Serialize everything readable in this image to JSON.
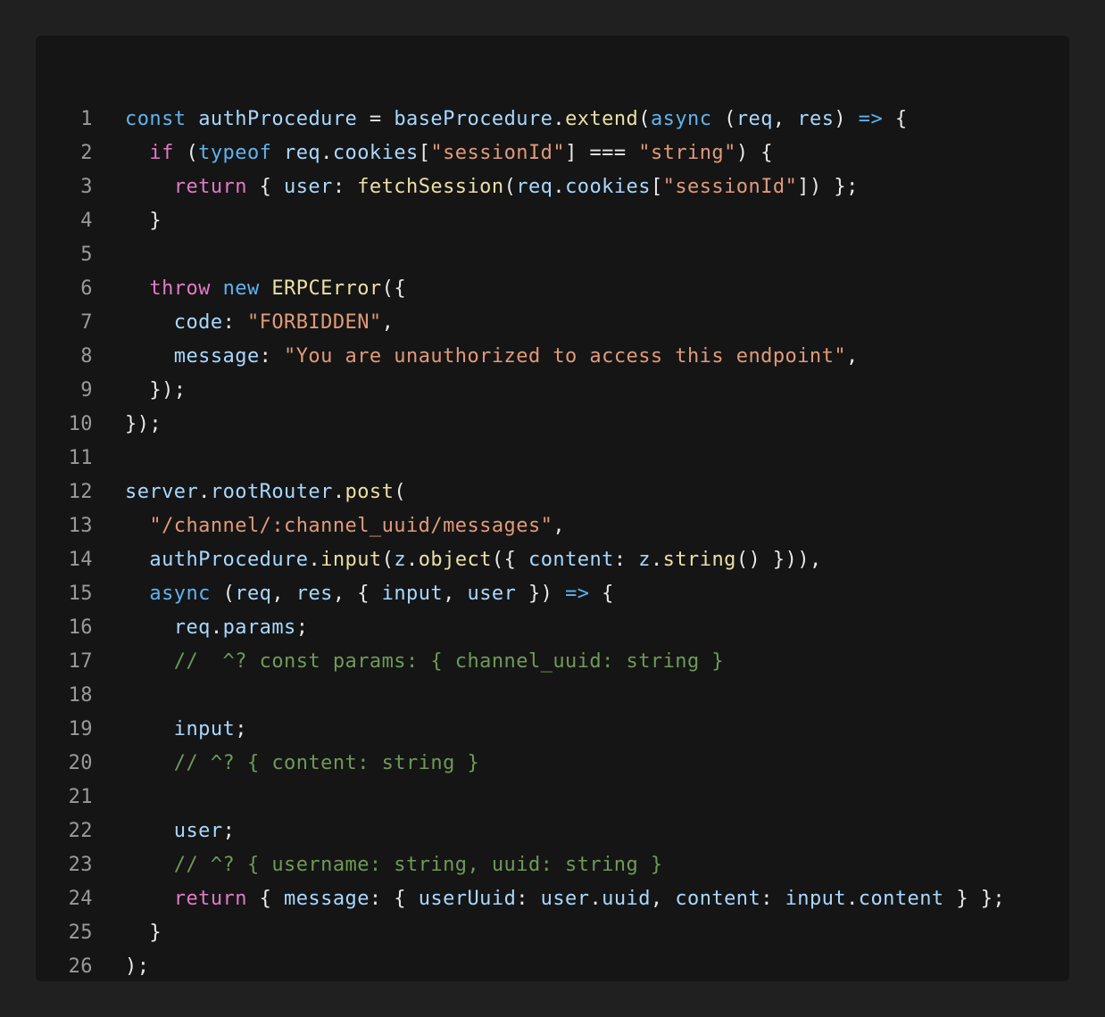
{
  "editor": {
    "colors": {
      "page_background": "#202020",
      "panel_background": "#151515",
      "line_number": "#9a9a9a",
      "keyword": "#5fb3f0",
      "control_keyword": "#e37ac8",
      "function": "#eae0a6",
      "identifier": "#a8d8ff",
      "string": "#e09a7a",
      "comment": "#6e9a57",
      "punctuation": "#e8e8e8"
    },
    "lines": [
      {
        "number": "1",
        "tokens": [
          [
            "kw",
            "const"
          ],
          [
            "pun",
            " "
          ],
          [
            "var",
            "authProcedure"
          ],
          [
            "pun",
            " = "
          ],
          [
            "var",
            "baseProcedure"
          ],
          [
            "pun",
            "."
          ],
          [
            "fn",
            "extend"
          ],
          [
            "pun",
            "("
          ],
          [
            "kw",
            "async"
          ],
          [
            "pun",
            " ("
          ],
          [
            "var",
            "req"
          ],
          [
            "pun",
            ", "
          ],
          [
            "var",
            "res"
          ],
          [
            "pun",
            ") "
          ],
          [
            "kw",
            "=>"
          ],
          [
            "pun",
            " {"
          ]
        ]
      },
      {
        "number": "2",
        "tokens": [
          [
            "pun",
            "  "
          ],
          [
            "ctl",
            "if"
          ],
          [
            "pun",
            " ("
          ],
          [
            "kw",
            "typeof"
          ],
          [
            "pun",
            " "
          ],
          [
            "var",
            "req"
          ],
          [
            "pun",
            "."
          ],
          [
            "var",
            "cookies"
          ],
          [
            "pun",
            "["
          ],
          [
            "str",
            "\"sessionId\""
          ],
          [
            "pun",
            "] === "
          ],
          [
            "str",
            "\"string\""
          ],
          [
            "pun",
            ") {"
          ]
        ]
      },
      {
        "number": "3",
        "tokens": [
          [
            "pun",
            "    "
          ],
          [
            "ctl",
            "return"
          ],
          [
            "pun",
            " { "
          ],
          [
            "var",
            "user"
          ],
          [
            "pun",
            ": "
          ],
          [
            "fn",
            "fetchSession"
          ],
          [
            "pun",
            "("
          ],
          [
            "var",
            "req"
          ],
          [
            "pun",
            "."
          ],
          [
            "var",
            "cookies"
          ],
          [
            "pun",
            "["
          ],
          [
            "str",
            "\"sessionId\""
          ],
          [
            "pun",
            "]) };"
          ]
        ]
      },
      {
        "number": "4",
        "tokens": [
          [
            "pun",
            "  }"
          ]
        ]
      },
      {
        "number": "5",
        "tokens": []
      },
      {
        "number": "6",
        "tokens": [
          [
            "pun",
            "  "
          ],
          [
            "ctl",
            "throw"
          ],
          [
            "pun",
            " "
          ],
          [
            "kw",
            "new"
          ],
          [
            "pun",
            " "
          ],
          [
            "fn",
            "ERPCError"
          ],
          [
            "pun",
            "({"
          ]
        ]
      },
      {
        "number": "7",
        "tokens": [
          [
            "pun",
            "    "
          ],
          [
            "var",
            "code"
          ],
          [
            "pun",
            ": "
          ],
          [
            "str",
            "\"FORBIDDEN\""
          ],
          [
            "pun",
            ","
          ]
        ]
      },
      {
        "number": "8",
        "tokens": [
          [
            "pun",
            "    "
          ],
          [
            "var",
            "message"
          ],
          [
            "pun",
            ": "
          ],
          [
            "str",
            "\"You are unauthorized to access this endpoint\""
          ],
          [
            "pun",
            ","
          ]
        ]
      },
      {
        "number": "9",
        "tokens": [
          [
            "pun",
            "  });"
          ]
        ]
      },
      {
        "number": "10",
        "tokens": [
          [
            "pun",
            "});"
          ]
        ]
      },
      {
        "number": "11",
        "tokens": []
      },
      {
        "number": "12",
        "tokens": [
          [
            "var",
            "server"
          ],
          [
            "pun",
            "."
          ],
          [
            "var",
            "rootRouter"
          ],
          [
            "pun",
            "."
          ],
          [
            "fn",
            "post"
          ],
          [
            "pun",
            "("
          ]
        ]
      },
      {
        "number": "13",
        "tokens": [
          [
            "pun",
            "  "
          ],
          [
            "str",
            "\"/channel/:channel_uuid/messages\""
          ],
          [
            "pun",
            ","
          ]
        ]
      },
      {
        "number": "14",
        "tokens": [
          [
            "pun",
            "  "
          ],
          [
            "var",
            "authProcedure"
          ],
          [
            "pun",
            "."
          ],
          [
            "fn",
            "input"
          ],
          [
            "pun",
            "("
          ],
          [
            "var",
            "z"
          ],
          [
            "pun",
            "."
          ],
          [
            "fn",
            "object"
          ],
          [
            "pun",
            "({ "
          ],
          [
            "var",
            "content"
          ],
          [
            "pun",
            ": "
          ],
          [
            "var",
            "z"
          ],
          [
            "pun",
            "."
          ],
          [
            "fn",
            "string"
          ],
          [
            "pun",
            "() })),"
          ]
        ]
      },
      {
        "number": "15",
        "tokens": [
          [
            "pun",
            "  "
          ],
          [
            "kw",
            "async"
          ],
          [
            "pun",
            " ("
          ],
          [
            "var",
            "req"
          ],
          [
            "pun",
            ", "
          ],
          [
            "var",
            "res"
          ],
          [
            "pun",
            ", { "
          ],
          [
            "var",
            "input"
          ],
          [
            "pun",
            ", "
          ],
          [
            "var",
            "user"
          ],
          [
            "pun",
            " }) "
          ],
          [
            "kw",
            "=>"
          ],
          [
            "pun",
            " {"
          ]
        ]
      },
      {
        "number": "16",
        "tokens": [
          [
            "pun",
            "    "
          ],
          [
            "var",
            "req"
          ],
          [
            "pun",
            "."
          ],
          [
            "var",
            "params"
          ],
          [
            "pun",
            ";"
          ]
        ]
      },
      {
        "number": "17",
        "tokens": [
          [
            "pun",
            "    "
          ],
          [
            "cmt",
            "//  ^? const params: { channel_uuid: string }"
          ]
        ]
      },
      {
        "number": "18",
        "tokens": []
      },
      {
        "number": "19",
        "tokens": [
          [
            "pun",
            "    "
          ],
          [
            "var",
            "input"
          ],
          [
            "pun",
            ";"
          ]
        ]
      },
      {
        "number": "20",
        "tokens": [
          [
            "pun",
            "    "
          ],
          [
            "cmt",
            "// ^? { content: string }"
          ]
        ]
      },
      {
        "number": "21",
        "tokens": []
      },
      {
        "number": "22",
        "tokens": [
          [
            "pun",
            "    "
          ],
          [
            "var",
            "user"
          ],
          [
            "pun",
            ";"
          ]
        ]
      },
      {
        "number": "23",
        "tokens": [
          [
            "pun",
            "    "
          ],
          [
            "cmt",
            "// ^? { username: string, uuid: string }"
          ]
        ]
      },
      {
        "number": "24",
        "tokens": [
          [
            "pun",
            "    "
          ],
          [
            "ctl",
            "return"
          ],
          [
            "pun",
            " { "
          ],
          [
            "var",
            "message"
          ],
          [
            "pun",
            ": { "
          ],
          [
            "var",
            "userUuid"
          ],
          [
            "pun",
            ": "
          ],
          [
            "var",
            "user"
          ],
          [
            "pun",
            "."
          ],
          [
            "var",
            "uuid"
          ],
          [
            "pun",
            ", "
          ],
          [
            "var",
            "content"
          ],
          [
            "pun",
            ": "
          ],
          [
            "var",
            "input"
          ],
          [
            "pun",
            "."
          ],
          [
            "var",
            "content"
          ],
          [
            "pun",
            " } };"
          ]
        ]
      },
      {
        "number": "25",
        "tokens": [
          [
            "pun",
            "  }"
          ]
        ]
      },
      {
        "number": "26",
        "tokens": [
          [
            "pun",
            ");"
          ]
        ]
      }
    ]
  }
}
